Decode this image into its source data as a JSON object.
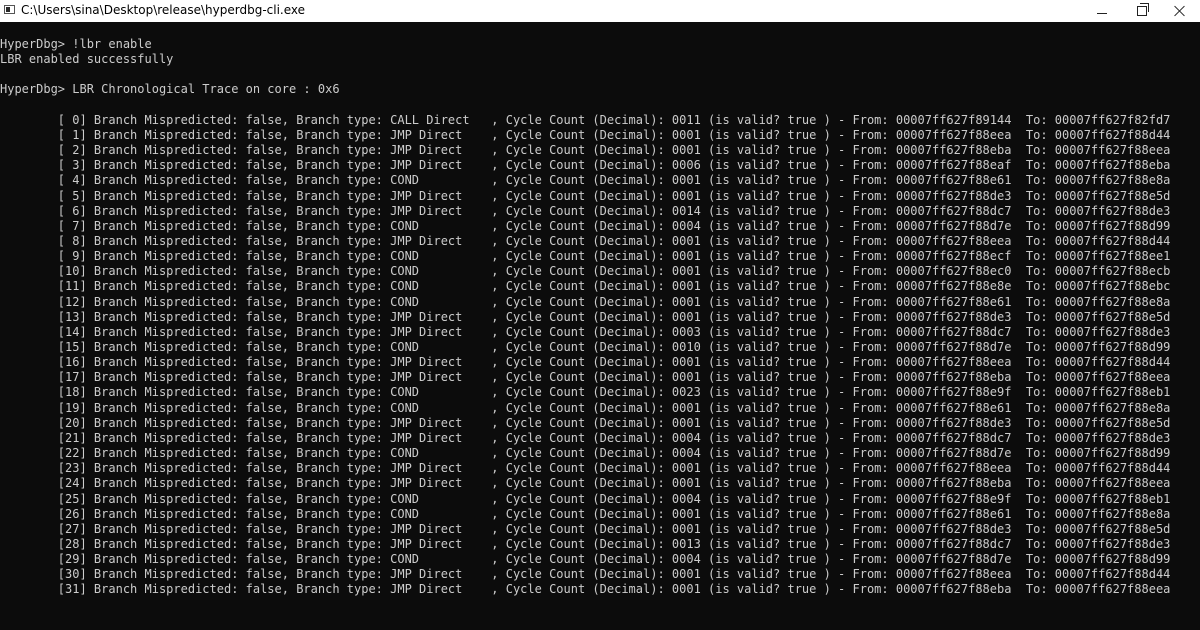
{
  "window": {
    "title": "C:\\Users\\sina\\Desktop\\release\\hyperdbg-cli.exe",
    "controls": {
      "minimize": "minimize",
      "maximize": "maximize",
      "close": "close"
    }
  },
  "console": {
    "lines": [
      "HyperDbg> !lbr enable",
      "LBR enabled successfully",
      "",
      "HyperDbg> LBR Chronological Trace on core : 0x6",
      "",
      "        [ 0] Branch Mispredicted: false, Branch type: CALL Direct   , Cycle Count (Decimal): 0011 (is valid? true ) - From: 00007ff627f89144  To: 00007ff627f82fd7",
      "        [ 1] Branch Mispredicted: false, Branch type: JMP Direct    , Cycle Count (Decimal): 0001 (is valid? true ) - From: 00007ff627f88eea  To: 00007ff627f88d44",
      "        [ 2] Branch Mispredicted: false, Branch type: JMP Direct    , Cycle Count (Decimal): 0001 (is valid? true ) - From: 00007ff627f88eba  To: 00007ff627f88eea",
      "        [ 3] Branch Mispredicted: false, Branch type: JMP Direct    , Cycle Count (Decimal): 0006 (is valid? true ) - From: 00007ff627f88eaf  To: 00007ff627f88eba",
      "        [ 4] Branch Mispredicted: false, Branch type: COND          , Cycle Count (Decimal): 0001 (is valid? true ) - From: 00007ff627f88e61  To: 00007ff627f88e8a",
      "        [ 5] Branch Mispredicted: false, Branch type: JMP Direct    , Cycle Count (Decimal): 0001 (is valid? true ) - From: 00007ff627f88de3  To: 00007ff627f88e5d",
      "        [ 6] Branch Mispredicted: false, Branch type: JMP Direct    , Cycle Count (Decimal): 0014 (is valid? true ) - From: 00007ff627f88dc7  To: 00007ff627f88de3",
      "        [ 7] Branch Mispredicted: false, Branch type: COND          , Cycle Count (Decimal): 0004 (is valid? true ) - From: 00007ff627f88d7e  To: 00007ff627f88d99",
      "        [ 8] Branch Mispredicted: false, Branch type: JMP Direct    , Cycle Count (Decimal): 0001 (is valid? true ) - From: 00007ff627f88eea  To: 00007ff627f88d44",
      "        [ 9] Branch Mispredicted: false, Branch type: COND          , Cycle Count (Decimal): 0001 (is valid? true ) - From: 00007ff627f88ecf  To: 00007ff627f88ee1",
      "        [10] Branch Mispredicted: false, Branch type: COND          , Cycle Count (Decimal): 0001 (is valid? true ) - From: 00007ff627f88ec0  To: 00007ff627f88ecb",
      "        [11] Branch Mispredicted: false, Branch type: COND          , Cycle Count (Decimal): 0001 (is valid? true ) - From: 00007ff627f88e8e  To: 00007ff627f88ebc",
      "        [12] Branch Mispredicted: false, Branch type: COND          , Cycle Count (Decimal): 0001 (is valid? true ) - From: 00007ff627f88e61  To: 00007ff627f88e8a",
      "        [13] Branch Mispredicted: false, Branch type: JMP Direct    , Cycle Count (Decimal): 0001 (is valid? true ) - From: 00007ff627f88de3  To: 00007ff627f88e5d",
      "        [14] Branch Mispredicted: false, Branch type: JMP Direct    , Cycle Count (Decimal): 0003 (is valid? true ) - From: 00007ff627f88dc7  To: 00007ff627f88de3",
      "        [15] Branch Mispredicted: false, Branch type: COND          , Cycle Count (Decimal): 0010 (is valid? true ) - From: 00007ff627f88d7e  To: 00007ff627f88d99",
      "        [16] Branch Mispredicted: false, Branch type: JMP Direct    , Cycle Count (Decimal): 0001 (is valid? true ) - From: 00007ff627f88eea  To: 00007ff627f88d44",
      "        [17] Branch Mispredicted: false, Branch type: JMP Direct    , Cycle Count (Decimal): 0001 (is valid? true ) - From: 00007ff627f88eba  To: 00007ff627f88eea",
      "        [18] Branch Mispredicted: false, Branch type: COND          , Cycle Count (Decimal): 0023 (is valid? true ) - From: 00007ff627f88e9f  To: 00007ff627f88eb1",
      "        [19] Branch Mispredicted: false, Branch type: COND          , Cycle Count (Decimal): 0001 (is valid? true ) - From: 00007ff627f88e61  To: 00007ff627f88e8a",
      "        [20] Branch Mispredicted: false, Branch type: JMP Direct    , Cycle Count (Decimal): 0001 (is valid? true ) - From: 00007ff627f88de3  To: 00007ff627f88e5d",
      "        [21] Branch Mispredicted: false, Branch type: JMP Direct    , Cycle Count (Decimal): 0004 (is valid? true ) - From: 00007ff627f88dc7  To: 00007ff627f88de3",
      "        [22] Branch Mispredicted: false, Branch type: COND          , Cycle Count (Decimal): 0004 (is valid? true ) - From: 00007ff627f88d7e  To: 00007ff627f88d99",
      "        [23] Branch Mispredicted: false, Branch type: JMP Direct    , Cycle Count (Decimal): 0001 (is valid? true ) - From: 00007ff627f88eea  To: 00007ff627f88d44",
      "        [24] Branch Mispredicted: false, Branch type: JMP Direct    , Cycle Count (Decimal): 0001 (is valid? true ) - From: 00007ff627f88eba  To: 00007ff627f88eea",
      "        [25] Branch Mispredicted: false, Branch type: COND          , Cycle Count (Decimal): 0004 (is valid? true ) - From: 00007ff627f88e9f  To: 00007ff627f88eb1",
      "        [26] Branch Mispredicted: false, Branch type: COND          , Cycle Count (Decimal): 0001 (is valid? true ) - From: 00007ff627f88e61  To: 00007ff627f88e8a",
      "        [27] Branch Mispredicted: false, Branch type: JMP Direct    , Cycle Count (Decimal): 0001 (is valid? true ) - From: 00007ff627f88de3  To: 00007ff627f88e5d",
      "        [28] Branch Mispredicted: false, Branch type: JMP Direct    , Cycle Count (Decimal): 0013 (is valid? true ) - From: 00007ff627f88dc7  To: 00007ff627f88de3",
      "        [29] Branch Mispredicted: false, Branch type: COND          , Cycle Count (Decimal): 0004 (is valid? true ) - From: 00007ff627f88d7e  To: 00007ff627f88d99",
      "        [30] Branch Mispredicted: false, Branch type: JMP Direct    , Cycle Count (Decimal): 0001 (is valid? true ) - From: 00007ff627f88eea  To: 00007ff627f88d44",
      "        [31] Branch Mispredicted: false, Branch type: JMP Direct    , Cycle Count (Decimal): 0001 (is valid? true ) - From: 00007ff627f88eba  To: 00007ff627f88eea"
    ]
  },
  "colors": {
    "console_bg": "#0c0c0c",
    "console_text": "#cccccc",
    "titlebar_bg": "#ffffff"
  }
}
